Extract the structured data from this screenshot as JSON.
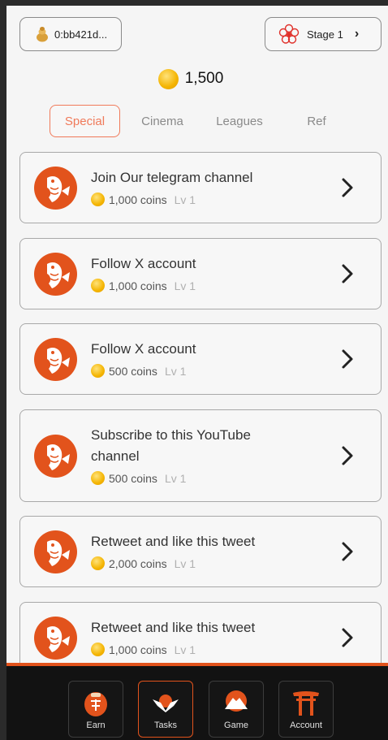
{
  "header": {
    "wallet_address": "0:bb421d...",
    "wallet_icon": "coin-bag-icon",
    "stage_label": "Stage 1",
    "stage_icon": "sakura-icon"
  },
  "balance": {
    "amount": "1,500",
    "icon": "coin-icon"
  },
  "tabs": [
    {
      "label": "Special",
      "active": true
    },
    {
      "label": "Cinema",
      "active": false
    },
    {
      "label": "Leagues",
      "active": false
    },
    {
      "label": "Ref",
      "active": false
    }
  ],
  "tasks": [
    {
      "title": "Join Our telegram channel",
      "reward": "1,000 coins",
      "level": "Lv 1"
    },
    {
      "title": "Follow X account",
      "reward": "1,000 coins",
      "level": "Lv 1"
    },
    {
      "title": "Follow X account",
      "reward": "500 coins",
      "level": "Lv 1"
    },
    {
      "title": "Subscribe to this YouTube channel",
      "reward": "500 coins",
      "level": "Lv 1"
    },
    {
      "title": "Retweet and like this tweet",
      "reward": "2,000 coins",
      "level": "Lv 1"
    },
    {
      "title": "Retweet and like this tweet",
      "reward": "1,000 coins",
      "level": "Lv 1"
    }
  ],
  "nav": [
    {
      "label": "Earn",
      "icon": "earn-icon",
      "active": false
    },
    {
      "label": "Tasks",
      "icon": "tasks-icon",
      "active": true
    },
    {
      "label": "Game",
      "icon": "mountain-icon",
      "active": false
    },
    {
      "label": "Account",
      "icon": "torii-gate-icon",
      "active": false
    }
  ],
  "colors": {
    "accent": "#e2531c",
    "tab_active": "#f07a5a",
    "background": "#f5f5f5",
    "nav_bg": "#121212"
  }
}
